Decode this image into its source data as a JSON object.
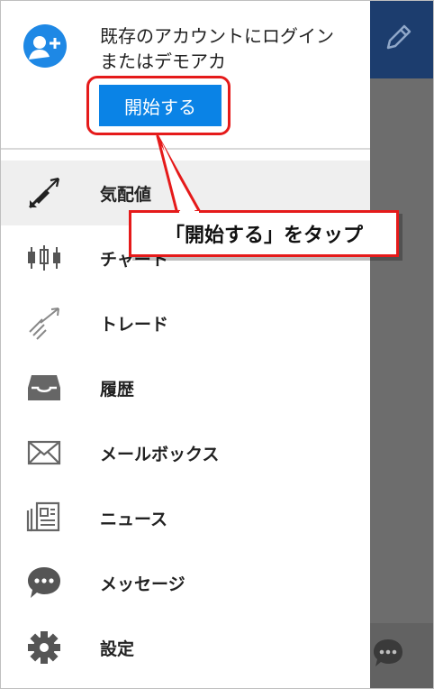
{
  "drawer": {
    "header_text": "既存のアカウントにログインまたはデモアカ",
    "start_button": "開始する",
    "items": [
      {
        "label": "気配値",
        "icon": "quotes-arrows-icon"
      },
      {
        "label": "チャート",
        "icon": "candlestick-icon"
      },
      {
        "label": "トレード",
        "icon": "trade-trend-icon"
      },
      {
        "label": "履歴",
        "icon": "inbox-tray-icon"
      },
      {
        "label": "メールボックス",
        "icon": "mail-icon"
      },
      {
        "label": "ニュース",
        "icon": "newspaper-icon"
      },
      {
        "label": "メッセージ",
        "icon": "chat-bubble-icon"
      },
      {
        "label": "設定",
        "icon": "gear-icon"
      }
    ]
  },
  "callout": {
    "text": "「開始する」をタップ"
  },
  "colors": {
    "accent": "#0a83e6",
    "highlight": "#e51a1a",
    "header": "#1c3d6e"
  }
}
